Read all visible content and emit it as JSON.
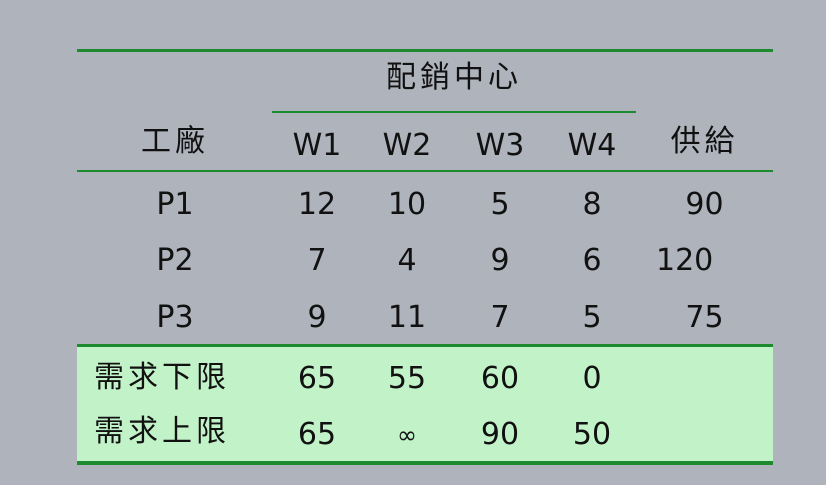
{
  "table": {
    "group_header": "配銷中心",
    "row_header": "工廠",
    "supply_header": "供給",
    "columns": [
      "W1",
      "W2",
      "W3",
      "W4"
    ],
    "rows": [
      {
        "label": "P1",
        "values": [
          "12",
          "10",
          "5",
          "8"
        ],
        "supply": "90"
      },
      {
        "label": "P2",
        "values": [
          "7",
          "4",
          "9",
          "6"
        ],
        "supply": "120"
      },
      {
        "label": "P3",
        "values": [
          "9",
          "11",
          "7",
          "5"
        ],
        "supply": "75"
      }
    ],
    "demand_rows": [
      {
        "label": "需求下限",
        "values": [
          "65",
          "55",
          "60",
          "0"
        ]
      },
      {
        "label": "需求上限",
        "values": [
          "65",
          "∞",
          "90",
          "50"
        ]
      }
    ]
  }
}
